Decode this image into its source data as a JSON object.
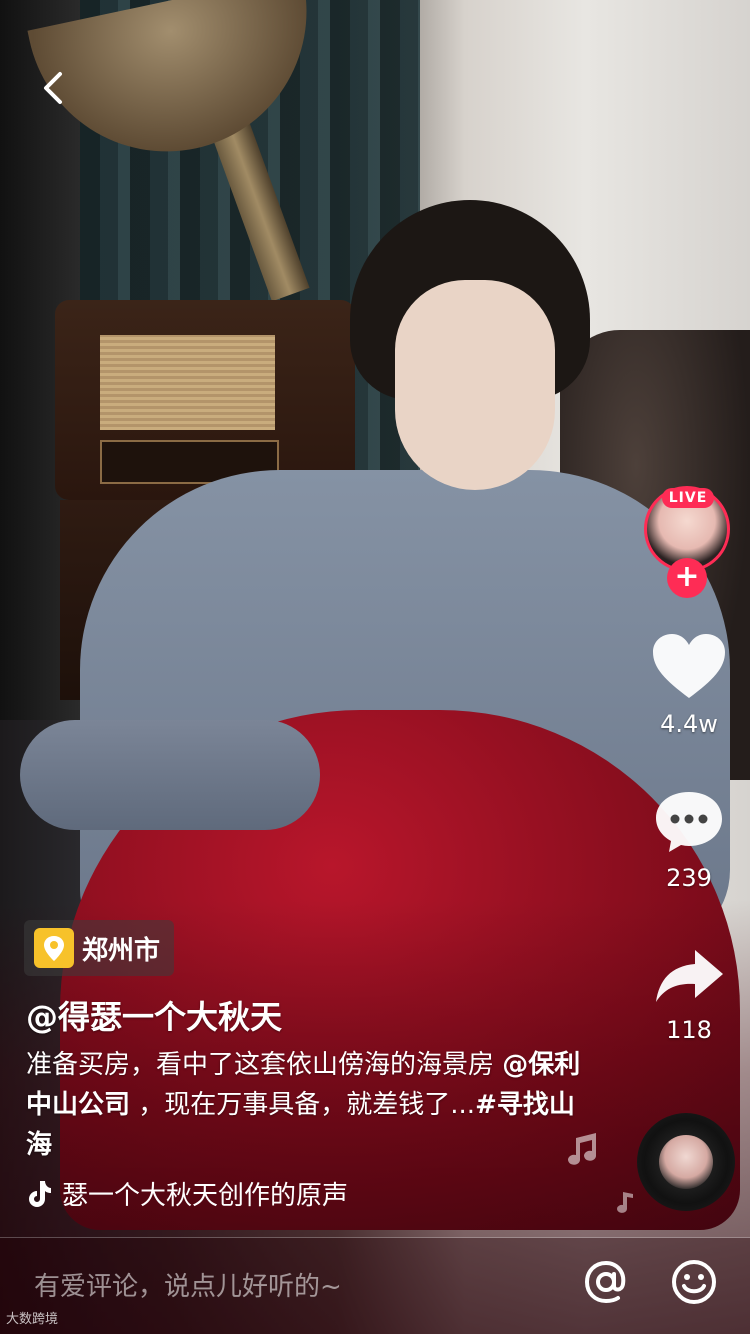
{
  "sidebar": {
    "live_badge": "LIVE",
    "likes": "4.4w",
    "comments": "239",
    "shares": "118"
  },
  "video": {
    "location": "郑州市",
    "author": "@得瑟一个大秋天",
    "description_plain_1": "准备买房，看中了这套依山傍海的海景房 ",
    "mention": "@保利中山公司",
    "description_plain_2": " ，现在万事具备，就差钱了...",
    "hashtag": "#寻找山海",
    "music": "瑟一个大秋天创作的原声"
  },
  "comment_bar": {
    "placeholder": "有爱评论，说点儿好听的~"
  },
  "watermark": "大数跨境",
  "colors": {
    "accent": "#fe2c55",
    "location_icon": "#f7c22a"
  }
}
